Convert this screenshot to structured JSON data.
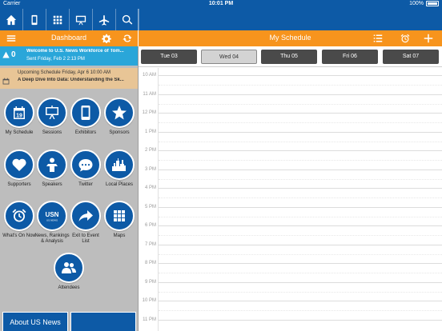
{
  "status": {
    "carrier": "Carrier",
    "time": "10:01 PM",
    "battery": "100%"
  },
  "nav": {
    "icons": [
      "home-icon",
      "phone-icon",
      "grid-icon",
      "easel-icon",
      "plane-icon",
      "search-icon"
    ]
  },
  "left_header": {
    "title": "Dashboard"
  },
  "right_header": {
    "title": "My Schedule"
  },
  "alert": {
    "count": "0",
    "title": "Welcome to U.S. News Workforce of Tom...",
    "sub": "Sent Friday, Feb 2 2:13 PM"
  },
  "upcoming": {
    "title": "Upcoming Schedule Friday, Apr 6 10:00 AM",
    "sub": "A Deep Dive Into Data: Understanding the Sk..."
  },
  "tiles": [
    {
      "label": "My Schedule",
      "icon": "calendar-icon"
    },
    {
      "label": "Sessions",
      "icon": "easel-icon"
    },
    {
      "label": "Exhibitors",
      "icon": "phone-icon"
    },
    {
      "label": "Sponsors",
      "icon": "star-icon"
    },
    {
      "label": "Supporters",
      "icon": "heart-icon"
    },
    {
      "label": "Speakers",
      "icon": "speaker-icon"
    },
    {
      "label": "Twitter",
      "icon": "twitter-icon"
    },
    {
      "label": "Local Places",
      "icon": "city-icon"
    },
    {
      "label": "What's On Now",
      "icon": "clock-icon"
    },
    {
      "label": "News, Rankings & Analysis",
      "icon": "usn-logo-icon",
      "icon_text": "USN",
      "icon_subtext": "US.NEWS"
    },
    {
      "label": "Exit to Event List",
      "icon": "share-arrow-icon"
    },
    {
      "label": "Maps",
      "icon": "grid-icon"
    },
    {
      "label": "Attendees",
      "icon": "people-icon"
    }
  ],
  "about": {
    "label": "About US News"
  },
  "days": [
    {
      "label": "Tue 03",
      "active": false
    },
    {
      "label": "Wed 04",
      "active": true
    },
    {
      "label": "Thu 05",
      "active": false
    },
    {
      "label": "Fri 06",
      "active": false
    },
    {
      "label": "Sat 07",
      "active": false
    }
  ],
  "hours": [
    "10 AM",
    "11 AM",
    "12 PM",
    "1 PM",
    "2 PM",
    "3 PM",
    "4 PM",
    "5 PM",
    "6 PM",
    "7 PM",
    "8 PM",
    "9 PM",
    "10 PM",
    "11 PM"
  ],
  "colors": {
    "brand_blue": "#0d5aa6",
    "header_orange": "#f7941d",
    "alert_blue": "#2aa6d9",
    "upcoming_tan": "#e8c596"
  }
}
